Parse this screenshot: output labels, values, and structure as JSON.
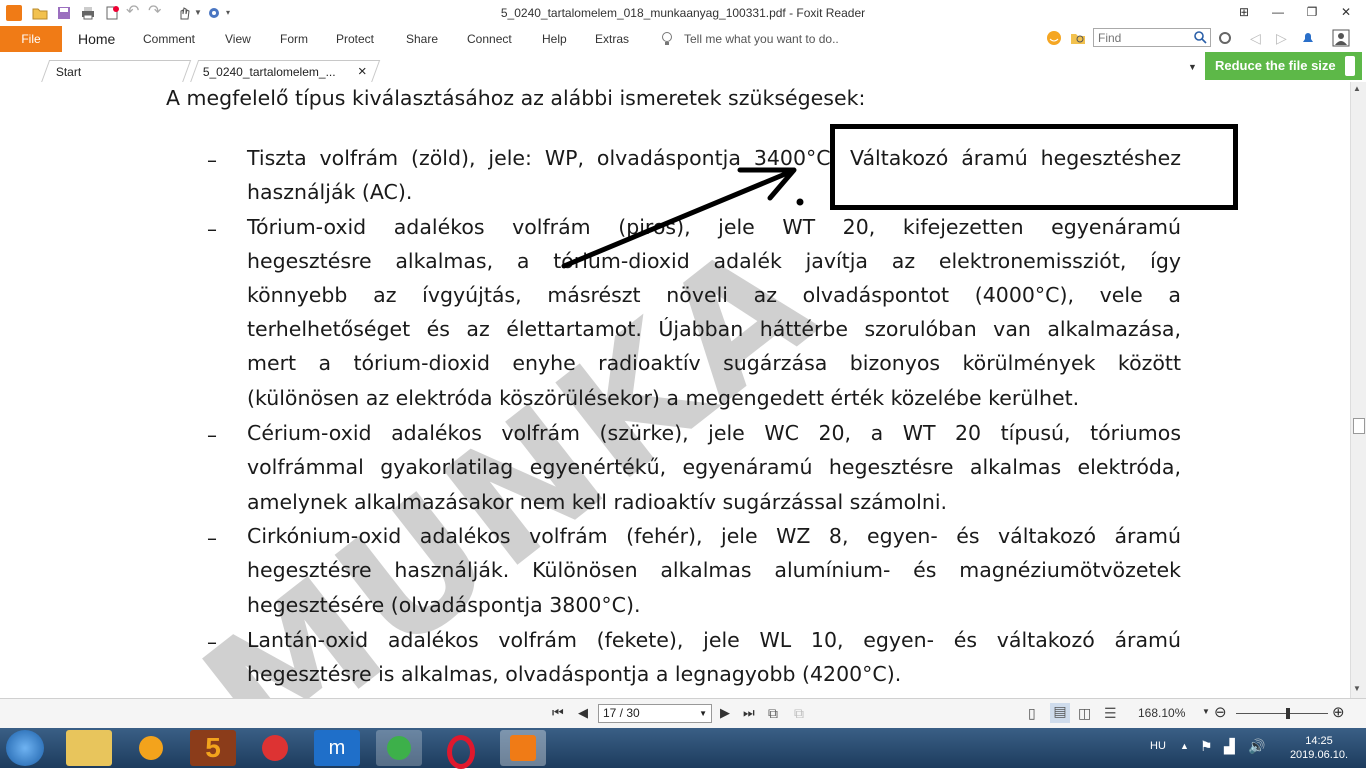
{
  "window": {
    "title": "5_0240_tartalomelem_018_munkaanyag_100331.pdf - Foxit Reader"
  },
  "ribbon": {
    "file_label": "File",
    "tabs": [
      "Home",
      "Comment",
      "View",
      "Form",
      "Protect",
      "Share",
      "Connect",
      "Help",
      "Extras"
    ],
    "tell_me": "Tell me what you want to do..",
    "find_placeholder": "Find"
  },
  "doc_tabs": {
    "start": "Start",
    "current": "5_0240_tartalomelem_...",
    "close_glyph": "×",
    "promo": "Reduce the file size"
  },
  "document": {
    "intro": "A megfelelő típus kiválasztásához az alábbi ismeretek szükségesek:",
    "watermark": "MUNKA",
    "dash": "–",
    "items": [
      {
        "lines": [
          "Tiszta volfrám (zöld), jele: WP, olvadáspontja 3400°C. Váltakozó áramú hegesztéshez",
          "használják (AC)."
        ]
      },
      {
        "lines": [
          "Tórium-oxid adalékos volfrám (piros), jele WT 20, kifejezetten egyenáramú",
          "hegesztésre alkalmas, a tórium-dioxid adalék javítja az elektronemissziót, így",
          "könnyebb az ívgyújtás, másrészt növeli az olvadáspontot (4000°C), vele a",
          "terhelhetőséget és az élettartamot. Újabban háttérbe szorulóban van alkalmazása,",
          "mert a tórium-dioxid enyhe radioaktív sugárzása bizonyos körülmények között",
          "(különösen az elektróda köszörülésekor) a megengedett érték közelébe kerülhet."
        ]
      },
      {
        "lines": [
          "Cérium-oxid adalékos volfrám (szürke), jele WC 20, a WT 20 típusú, tóriumos",
          "volfrámmal gyakorlatilag egyenértékű, egyenáramú hegesztésre alkalmas elektróda,",
          "amelynek alkalmazásakor nem kell radioaktív sugárzással számolni."
        ]
      },
      {
        "lines": [
          "Cirkónium-oxid adalékos volfrám (fehér), jele WZ 8, egyen- és váltakozó áramú",
          "hegesztésre használják. Különösen alkalmas alumínium- és magnéziumötvözetek",
          "hegesztésére (olvadáspontja 3800°C)."
        ]
      },
      {
        "lines": [
          "Lantán-oxid adalékos volfrám (fekete), jele WL 10, egyen- és váltakozó áramú",
          "hegesztésre is alkalmas, olvadáspontja a legnagyobb (4200°C)."
        ]
      }
    ]
  },
  "statusbar": {
    "page": "17 / 30",
    "zoom": "168.10%"
  },
  "taskbar": {
    "lang": "HU",
    "time": "14:25",
    "date": "2019.06.10."
  },
  "colors": {
    "accent": "#f07b16",
    "promo": "#5db848",
    "taskbar": "#2a4d73"
  }
}
